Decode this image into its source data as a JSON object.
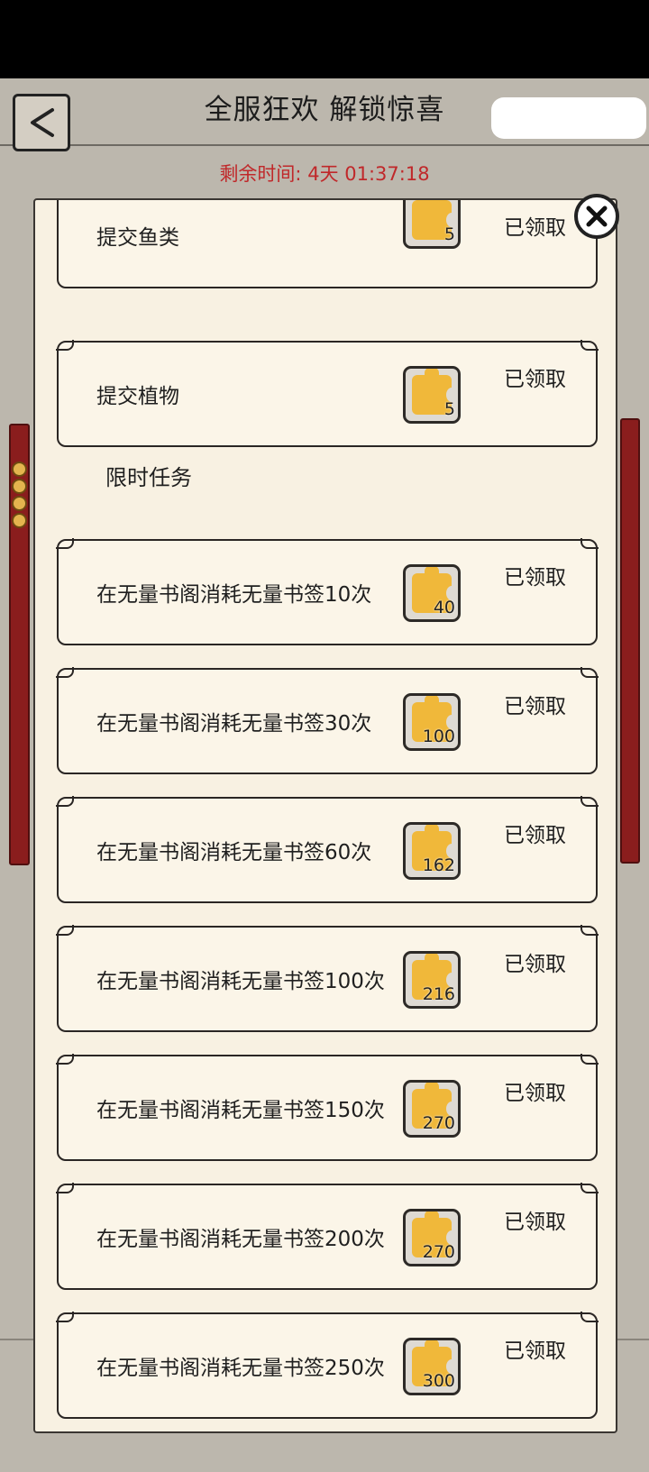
{
  "header": {
    "title": "全服狂欢 解锁惊喜",
    "countdown_label": "剩余时间:",
    "countdown_value": "4天 01:37:18"
  },
  "colors": {
    "accent_red": "#c0282a",
    "panel_bg": "#f8f1e2",
    "puzzle_gold": "#f0b83a"
  },
  "icons": {
    "back": "back-icon",
    "close": "close-icon",
    "reward": "puzzle-piece-icon"
  },
  "tasks_top": [
    {
      "name": "提交鱼类",
      "reward": "5",
      "status": "已领取"
    },
    {
      "name": "提交植物",
      "reward": "5",
      "status": "已领取"
    }
  ],
  "section": {
    "limited_title": "限时任务"
  },
  "tasks_limited": [
    {
      "name": "在无量书阁消耗无量书签10次",
      "reward": "40",
      "status": "已领取"
    },
    {
      "name": "在无量书阁消耗无量书签30次",
      "reward": "100",
      "status": "已领取"
    },
    {
      "name": "在无量书阁消耗无量书签60次",
      "reward": "162",
      "status": "已领取"
    },
    {
      "name": "在无量书阁消耗无量书签100次",
      "reward": "216",
      "status": "已领取"
    },
    {
      "name": "在无量书阁消耗无量书签150次",
      "reward": "270",
      "status": "已领取"
    },
    {
      "name": "在无量书阁消耗无量书签200次",
      "reward": "270",
      "status": "已领取"
    },
    {
      "name": "在无量书阁消耗无量书签250次",
      "reward": "300",
      "status": "已领取"
    }
  ]
}
